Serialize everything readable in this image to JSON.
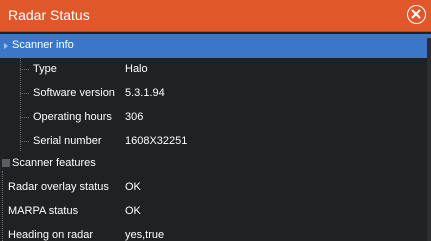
{
  "window": {
    "title": "Radar Status"
  },
  "sections": [
    {
      "label": "Scanner info",
      "items": [
        {
          "label": "Type",
          "value": "Halo"
        },
        {
          "label": "Software version",
          "value": "5.3.1.94"
        },
        {
          "label": "Operating hours",
          "value": "306"
        },
        {
          "label": "Serial number",
          "value": "1608X32251"
        }
      ]
    },
    {
      "label": "Scanner features"
    }
  ],
  "status_rows": [
    {
      "label": "Radar overlay status",
      "value": "OK"
    },
    {
      "label": "MARPA status",
      "value": "OK"
    },
    {
      "label": "Heading on radar",
      "value": "yes,true"
    }
  ],
  "icons": {
    "close": "close-circle-icon",
    "expanded": "expanded-arrow-icon",
    "collapsed": "collapsed-box-icon"
  },
  "colors": {
    "title_bar": "#e0582a",
    "selection": "#3b77c8",
    "background": "#1f2123",
    "text": "#ffffff"
  }
}
